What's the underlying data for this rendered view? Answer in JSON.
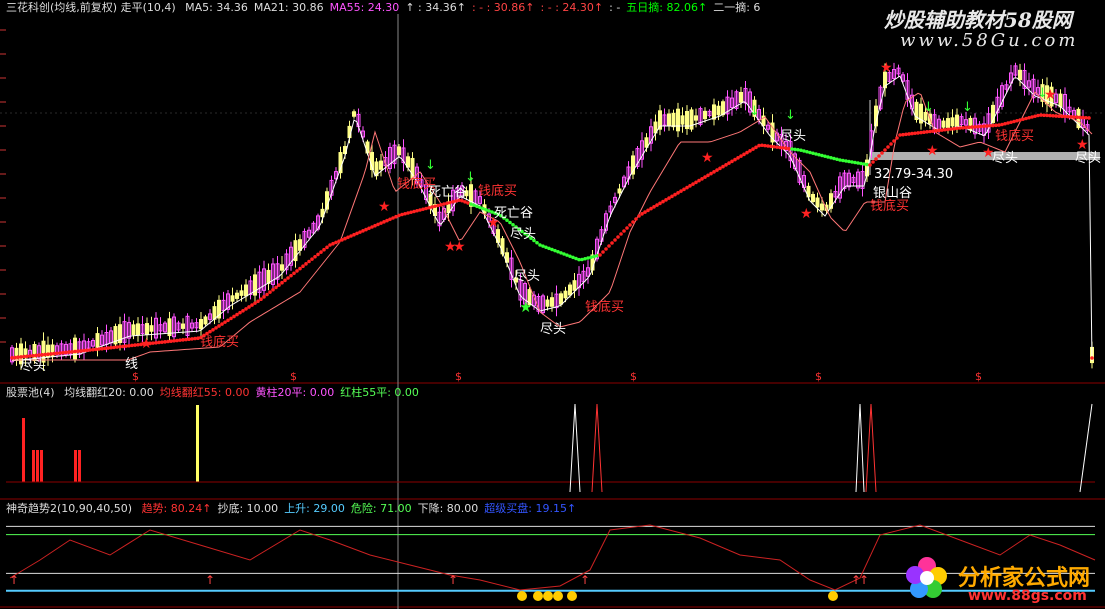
{
  "main_panel": {
    "stock_title": "三花科创(均线,前复权) 走平(10,4)",
    "ma_labels": [
      {
        "text": "MA5: 34.36",
        "color": "#dddddd"
      },
      {
        "text": "MA21: 30.86",
        "color": "#dddddd"
      },
      {
        "text": "MA55: 24.30",
        "color": "#ff55ff"
      },
      {
        "text": "↑ : 34.36↑",
        "color": "#dddddd"
      },
      {
        "text": ": -  : 30.86↑",
        "color": "#ff4444"
      },
      {
        "text": ": -  : 24.30↑",
        "color": "#ff4444"
      },
      {
        "text": ": -",
        "color": "#dddddd"
      },
      {
        "text": "五日摘: 82.06↑",
        "color": "#00ff00"
      },
      {
        "text": "二一摘: 6",
        "color": "#dddddd"
      }
    ],
    "annotations": [
      {
        "text": "钱底买",
        "color": "#ff3333"
      },
      {
        "text": "钱底买",
        "color": "#ff3333"
      },
      {
        "text": "钱底买",
        "color": "#ff3333"
      },
      {
        "text": "钱底买",
        "color": "#ff3333"
      },
      {
        "text": "钱底买",
        "color": "#ff3333"
      },
      {
        "text": "钱底买",
        "color": "#ff3333"
      },
      {
        "text": "尽头",
        "color": "#ffffff"
      },
      {
        "text": "尽头",
        "color": "#ffffff"
      },
      {
        "text": "尽头",
        "color": "#ffffff"
      },
      {
        "text": "尽头",
        "color": "#ffffff"
      },
      {
        "text": "尽头",
        "color": "#ffffff"
      },
      {
        "text": "尽头",
        "color": "#ffffff"
      },
      {
        "text": "尽头",
        "color": "#ffffff"
      },
      {
        "text": "死亡谷",
        "color": "#ffffff"
      },
      {
        "text": "死亡谷",
        "color": "#ffffff"
      },
      {
        "text": "银山谷",
        "color": "#ffffff"
      },
      {
        "text": "32.79-34.30",
        "color": "#ffffff"
      },
      {
        "text": "线",
        "color": "#ffffff"
      }
    ]
  },
  "sub_panel_1": {
    "title": "股票池(4)",
    "labels": [
      {
        "text": "均线翻红20: 0.00",
        "color": "#dddddd"
      },
      {
        "text": "均线翻红55: 0.00",
        "color": "#ff3333"
      },
      {
        "text": "黄柱20平: 0.00",
        "color": "#ff55ff"
      },
      {
        "text": "红柱55平: 0.00",
        "color": "#55ff55"
      }
    ]
  },
  "sub_panel_2": {
    "title": "神奇趋势2(10,90,40,50)",
    "labels": [
      {
        "text": "趋势: 80.24↑",
        "color": "#ff3333"
      },
      {
        "text": "抄底: 10.00",
        "color": "#dddddd"
      },
      {
        "text": "上升: 29.00",
        "color": "#55ccff"
      },
      {
        "text": "危险: 71.00",
        "color": "#55ff55"
      },
      {
        "text": "下降: 80.00",
        "color": "#dddddd"
      },
      {
        "text": "超级买盘: 19.15↑",
        "color": "#3355ff"
      }
    ]
  },
  "watermark": {
    "top_text": "炒股辅助教材58股网",
    "top_url": "www.58Gu.com",
    "bottom_text": "分析家公式网",
    "bottom_url": "www.88gs.com"
  },
  "colors": {
    "background": "#000000",
    "grid": "#8b0000",
    "up_candle": "#ff55ff",
    "down_candle": "#ffff88",
    "ma_slow_up": "#ff2020",
    "ma_slow_down": "#33ff33",
    "ma_fast": "#ffffff",
    "ma_mid": "#ff7777"
  },
  "chart_data": [
    {
      "type": "candlestick",
      "title": "",
      "series": [
        {
          "name": "MA5",
          "last": 34.36
        },
        {
          "name": "MA21",
          "last": 30.86
        },
        {
          "name": "MA55",
          "last": 24.3
        }
      ],
      "price_band": [
        32.79,
        34.3
      ]
    },
    {
      "type": "bar",
      "title": "股票池(4)",
      "values": {
        "均线翻红20": 0.0,
        "均线翻红55": 0.0,
        "黄柱20平": 0.0,
        "红柱55平": 0.0
      }
    },
    {
      "type": "line",
      "title": "神奇趋势2(10,90,40,50)",
      "values": {
        "趋势": 80.24,
        "抄底": 10.0,
        "上升": 29.0,
        "危险": 71.0,
        "下降": 80.0,
        "超级买盘": 19.15
      },
      "reference_lines": [
        10,
        29,
        71,
        80
      ]
    }
  ]
}
